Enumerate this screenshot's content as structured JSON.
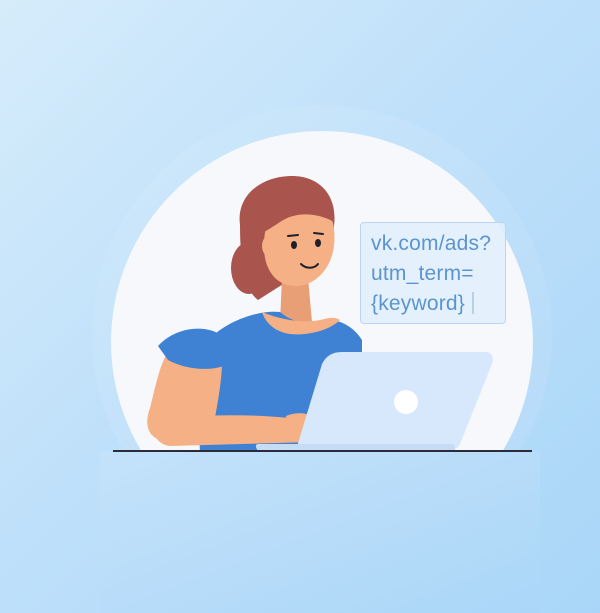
{
  "url_snippet": {
    "lines": [
      "vk.com/ads?",
      "utm_term=",
      "{keyword}"
    ]
  },
  "colors": {
    "background_light": "#d6ecfb",
    "background_dark": "#a9d6f8",
    "circle": "#f6f8fb",
    "hair": "#a9554e",
    "skin": "#f5b185",
    "shirt": "#3f82d4",
    "laptop": "#d7e8fd",
    "url_text": "#5b94cf",
    "desk_line": "#2b2b3a"
  },
  "icons": [
    "laptop-logo-icon"
  ]
}
